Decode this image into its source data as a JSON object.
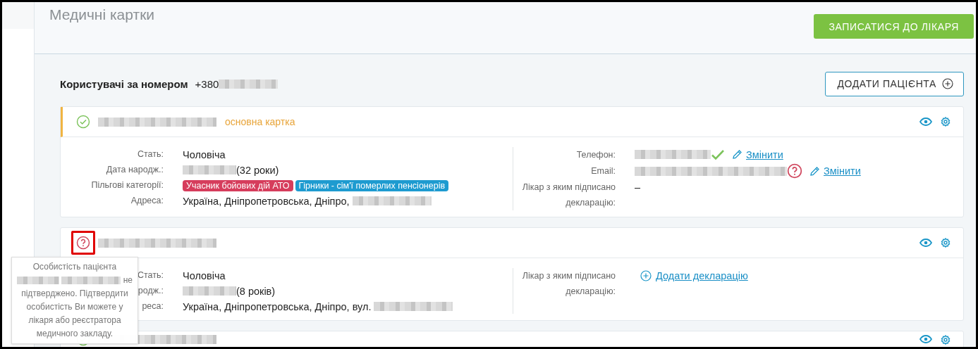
{
  "page_title": "Медичні картки",
  "book_button": "ЗАПИСАТИСЯ ДО ЛІКАРЯ",
  "users_heading": {
    "label": "Користувачі за номером",
    "phone_prefix": "+380"
  },
  "add_patient_button": "ДОДАТИ ПАЦІЄНТА",
  "cards": [
    {
      "verified": true,
      "highlighted": false,
      "primary": true,
      "primary_label": "основна картка",
      "left_fields": [
        {
          "kind": "text",
          "label": "Стать:",
          "value": "Чоловіча"
        },
        {
          "kind": "date",
          "label": "Дата народж.:",
          "value": "(32 роки)"
        },
        {
          "kind": "tags",
          "label": "Пільгові категорії:",
          "tags": [
            {
              "text": "Учасник бойових дій АТО",
              "color": "#d63d5c"
            },
            {
              "text": "Гірники - сім'ї померлих пенсіонерів",
              "color": "#1e9bd0"
            }
          ]
        },
        {
          "kind": "address",
          "label": "Адреса:",
          "value": "Україна, Дніпропетровська, Дніпро,"
        }
      ],
      "right_fields": [
        {
          "kind": "contact",
          "label": "Телефон:",
          "verified": true,
          "link": "Змінити"
        },
        {
          "kind": "contact",
          "label": "Email:",
          "verified": false,
          "link": "Змінити"
        },
        {
          "kind": "text",
          "label": "Лікар з яким підписано декларацію:",
          "value": "–"
        }
      ]
    },
    {
      "verified": false,
      "highlighted": true,
      "primary": false,
      "left_fields": [
        {
          "kind": "text",
          "label": "Стать:",
          "value": "Чоловіча"
        },
        {
          "kind": "date",
          "label": "родж.:",
          "value": "(8 років)"
        },
        {
          "kind": "address",
          "label": "реса:",
          "value": "Україна, Дніпропетровська, Дніпро, вул."
        }
      ],
      "right_fields": [
        {
          "kind": "action",
          "label": "Лікар з яким підписано декларацію:",
          "link": "Додати декларацію"
        }
      ]
    },
    {
      "verified": true,
      "highlighted": false,
      "primary": false
    }
  ],
  "tooltip": {
    "text_before": "Особистість пацієнта",
    "text_after": "не підтверджено. Підтвердити особистість Ви можете у лікаря або реєстратора медичного закладу."
  }
}
